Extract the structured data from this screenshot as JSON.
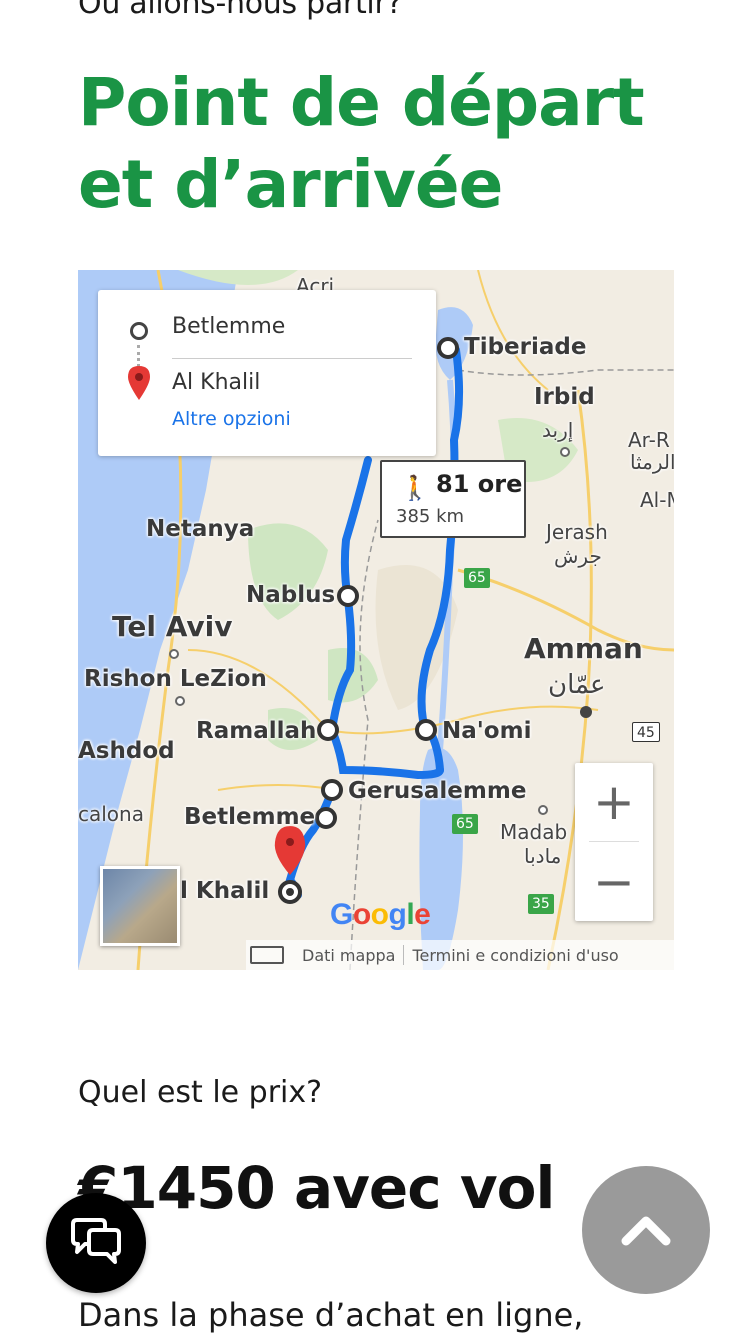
{
  "header": {
    "eyebrow": "Où allons-nous partir?",
    "title": "Point de départ et d’arrivée"
  },
  "map": {
    "directions": {
      "origin": "Betlemme",
      "destination": "Al Khalil",
      "more_options": "Altre opzioni"
    },
    "route": {
      "time": "81 ore",
      "distance": "385 km"
    },
    "places": {
      "acri": "Acri",
      "tiberiade": "Tiberiade",
      "irbid": "Irbid",
      "irbid_ar": "إربد",
      "ar_r": "Ar-R",
      "ar_r_ar": "الرمثا",
      "al_m": "Al-M",
      "netanya": "Netanya",
      "jerash": "Jerash",
      "jerash_ar": "جرش",
      "nablus": "Nablus",
      "tel_aviv": "Tel Aviv",
      "amman": "Amman",
      "amman_ar": "عمّان",
      "rishon": "Rishon LeZion",
      "ramallah": "Ramallah",
      "naomi": "Na'omi",
      "ashdod": "Ashdod",
      "gerusalemme": "Gerusalemme",
      "ascalona": "calona",
      "betlemme": "Betlemme",
      "madaba": "Madab",
      "madaba_ar": "مادبا",
      "al_khalil": "l Khalil"
    },
    "shields": {
      "r65a": "65",
      "r45": "45",
      "r65b": "65",
      "r35": "35"
    },
    "zoom_in": "+",
    "zoom_out": "−",
    "google_logo": "Google",
    "attribution": {
      "map_data": "Dati mappa",
      "terms": "Termini e condizioni d'uso"
    }
  },
  "pricing": {
    "eyebrow": "Quel est le prix?",
    "price": "€1450 avec vol",
    "body_start": "Dans la phase d’achat en ligne,"
  },
  "colors": {
    "title_green": "#1a9445",
    "route_blue": "#1a73e8",
    "scroll_top_bg": "#9a9a9a"
  }
}
